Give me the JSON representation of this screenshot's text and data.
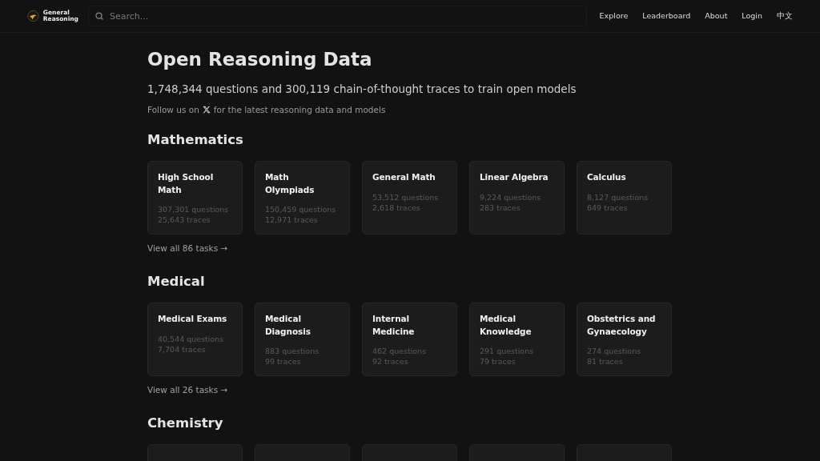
{
  "header": {
    "logo_text": [
      "General",
      "Reasoning"
    ],
    "search": {
      "placeholder": "Search..."
    },
    "nav": [
      "Explore",
      "Leaderboard",
      "About",
      "Login",
      "中文"
    ]
  },
  "hero": {
    "title": "Open Reasoning Data",
    "subtitle": "1,748,344 questions and 300,119 chain-of-thought traces to train open models",
    "follow_before": "Follow us on",
    "follow_after": "for the latest reasoning data and models"
  },
  "sections": [
    {
      "heading": "Mathematics",
      "cards": [
        {
          "kind": "task",
          "title": "High School Math",
          "questions": "307,301 questions",
          "traces": "25,643 traces"
        },
        {
          "kind": "task",
          "title": "Math Olympiads",
          "questions": "150,459 questions",
          "traces": "12,971 traces"
        },
        {
          "kind": "task",
          "title": "General Math",
          "questions": "53,512 questions",
          "traces": "2,618 traces"
        },
        {
          "kind": "task",
          "title": "Linear Algebra",
          "questions": "9,224 questions",
          "traces": "283 traces"
        },
        {
          "kind": "task",
          "title": "Calculus",
          "questions": "8,127 questions",
          "traces": "649 traces"
        }
      ],
      "view_all": "View all 86 tasks →"
    },
    {
      "heading": "Medical",
      "cards": [
        {
          "kind": "task",
          "title": "Medical Exams",
          "questions": "40,544 questions",
          "traces": "7,704 traces"
        },
        {
          "kind": "task",
          "title": "Medical Diagnosis",
          "questions": "883 questions",
          "traces": "99 traces"
        },
        {
          "kind": "task",
          "title": "Internal Medicine",
          "questions": "462 questions",
          "traces": "92 traces"
        },
        {
          "kind": "task",
          "title": "Medical Knowledge",
          "questions": "291 questions",
          "traces": "79 traces"
        },
        {
          "kind": "task",
          "title": "Obstetrics and Gynaecology",
          "questions": "274 questions",
          "traces": "81 traces"
        }
      ],
      "view_all": "View all 26 tasks →"
    },
    {
      "heading": "Chemistry",
      "cards": [
        {
          "kind": "cut"
        },
        {
          "kind": "cut"
        },
        {
          "kind": "cut"
        },
        {
          "kind": "cut"
        },
        {
          "kind": "cut"
        }
      ]
    }
  ]
}
